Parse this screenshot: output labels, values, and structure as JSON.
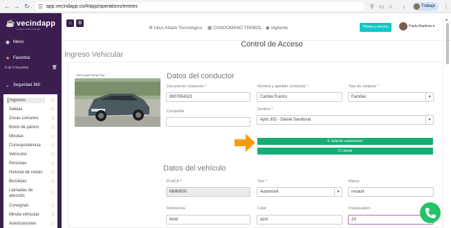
{
  "browser": {
    "url": "app.vecindapp.co/#/app/operations/entries",
    "profile": "Trabajo"
  },
  "sidebar": {
    "logo": "vecindapp",
    "logo_sub": "el que te cuida nunca sale",
    "menu_label": "Menú",
    "favorites_label": "Favoritos",
    "favorites_count": "0 de 5 favoritos",
    "section_label": "Seguridad 360",
    "items": [
      {
        "label": "Ingresos"
      },
      {
        "label": "Salidas"
      },
      {
        "label": "Zonas comunes"
      },
      {
        "label": "Botón de pánico"
      },
      {
        "label": "Minutas"
      },
      {
        "label": "Correspondencia"
      },
      {
        "label": "Vehículos"
      },
      {
        "label": "Personas"
      },
      {
        "label": "Historial de visitas"
      },
      {
        "label": "Bicicletas"
      },
      {
        "label": "Llamadas de atención"
      },
      {
        "label": "Consignas"
      },
      {
        "label": "Minuta vehicular"
      },
      {
        "label": "Autorizaciones"
      }
    ]
  },
  "header": {
    "crumb1": "Intus Aliado Tecnológico",
    "crumb2": "CONDOMINIO TREBOL",
    "crumb3": "Vigilante",
    "plans_button": "Planes y precios",
    "user_name": "Paola Martinez"
  },
  "page": {
    "heading": "Control de Acceso",
    "section_title": "Ingreso Vehicular",
    "photo_label": "Click para tomar foto"
  },
  "driver": {
    "title": "Datos del conductor",
    "doc_label": "Documento conductor *",
    "doc_value": "8907654321",
    "name_label": "Nombre y apellido conductor *",
    "name_value": "Camila Franco",
    "visitor_type_label": "Tipo de visitante *",
    "visitor_type_value": "Familiar",
    "company_label": "Compañía",
    "company_value": "",
    "destination_label": "Destino *",
    "destination_value": "Apto 302 - Daniel Sandoval",
    "authorize_button": "Solicitar autorización",
    "call_button": "Llamar"
  },
  "vehicle": {
    "title": "Datos del vehículo",
    "plate_label": "PLACA *",
    "plate_value": "MMM000",
    "type_label": "Tipo *",
    "type_value": "Automóvil",
    "brand_label": "Marca",
    "brand_value": "renault",
    "reference_label": "Referencia",
    "reference_value": "kwid",
    "color_label": "Color",
    "color_value": "azul",
    "parking_label": "Parqueadero",
    "parking_value": "23"
  },
  "colors": {
    "sidebar": "#3b1e4f",
    "accent_green": "#16ad74",
    "plans_teal": "#12c5c5",
    "arrow_orange": "#f39c12",
    "whatsapp": "#25c26a"
  }
}
